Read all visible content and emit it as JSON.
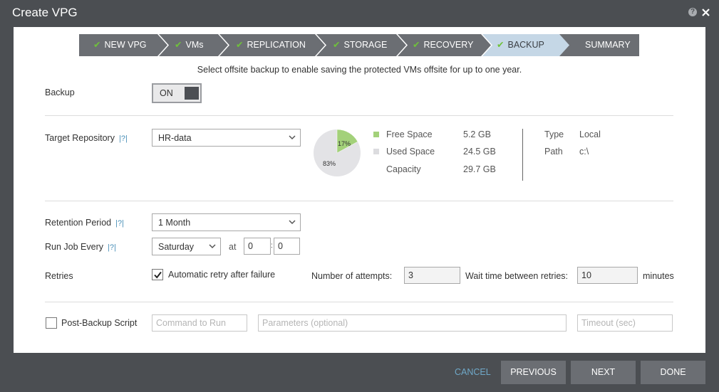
{
  "window": {
    "title": "Create VPG"
  },
  "wizard": {
    "steps": [
      {
        "label": "NEW VPG",
        "done": true
      },
      {
        "label": "VMs",
        "done": true
      },
      {
        "label": "REPLICATION",
        "done": true
      },
      {
        "label": "STORAGE",
        "done": true
      },
      {
        "label": "RECOVERY",
        "done": true
      },
      {
        "label": "BACKUP",
        "done": true
      },
      {
        "label": "SUMMARY",
        "done": false
      }
    ],
    "checkmark": "✔"
  },
  "subtitle": "Select offsite backup to enable saving the protected VMs offsite for up to one year.",
  "backup": {
    "label": "Backup",
    "toggle": "ON"
  },
  "repository": {
    "label": "Target Repository",
    "help": "|?|",
    "selected": "HR-data",
    "pie": {
      "free_pct_label": "17%",
      "used_pct_label": "83%",
      "free_fraction": 0.17
    },
    "free_label": "Free Space",
    "free_value": "5.2 GB",
    "used_label": "Used Space",
    "used_value": "24.5 GB",
    "capacity_label": "Capacity",
    "capacity_value": "29.7 GB",
    "type_label": "Type",
    "type_value": "Local",
    "path_label": "Path",
    "path_value": "c:\\",
    "colors": {
      "free": "#a3d17a",
      "used": "#e3e3e6"
    }
  },
  "retention": {
    "label": "Retention Period",
    "help": "|?|",
    "selected": "1 Month"
  },
  "runjob": {
    "label": "Run Job Every",
    "help": "|?|",
    "day": "Saturday",
    "at_label": "at",
    "hour": "0",
    "colon": ":",
    "minute": "0"
  },
  "retries": {
    "label": "Retries",
    "auto_label": "Automatic retry after failure",
    "attempts_label": "Number of attempts:",
    "attempts_value": "3",
    "wait_label": "Wait time between retries:",
    "wait_value": "10",
    "minutes_label": "minutes"
  },
  "script": {
    "label": "Post-Backup Script",
    "command_placeholder": "Command to Run",
    "params_placeholder": "Parameters (optional)",
    "timeout_placeholder": "Timeout (sec)"
  },
  "footer": {
    "cancel": "CANCEL",
    "previous": "PREVIOUS",
    "next": "NEXT",
    "done": "DONE"
  },
  "colors": {
    "accent_check": "#6fc23a",
    "chrome": "#4b4e52",
    "step_bg": "#6b6e73",
    "step_active": "#c5d7e6"
  }
}
